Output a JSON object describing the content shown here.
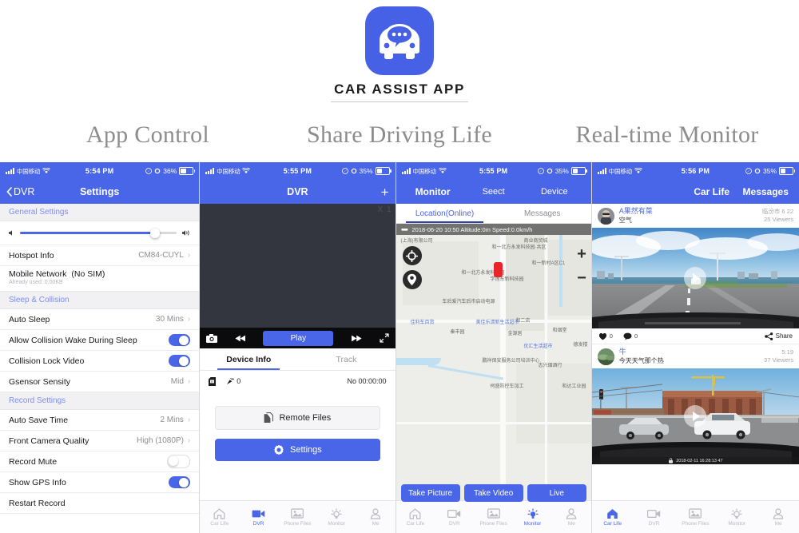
{
  "hero": {
    "logo_title": "CAR ASSIST APP",
    "logo_icon": "car-chat-logo-icon",
    "taglines": [
      "App Control",
      "Share Driving Life",
      "Real-time Monitor"
    ]
  },
  "colors": {
    "accent": "#4a66e8",
    "navbar": "#4a66e8",
    "section_header_text": "#7f8df0",
    "danger": "#e8262a"
  },
  "panels": {
    "settings": {
      "status": {
        "carrier": "中国移动",
        "time": "5:54 PM",
        "battery": "36%"
      },
      "nav": {
        "back_label": "DVR",
        "title": "Settings"
      },
      "section_general": "General Settings",
      "volume_percent": 86,
      "rows": [
        {
          "label": "Hotspot Info",
          "value": "CM84-CUYL",
          "type": "chevron"
        },
        {
          "label": "Mobile Network",
          "value": "(No SIM)",
          "sub": "Already used: 0.00KB",
          "type": "text2"
        }
      ],
      "section_sleep": "Sleep & Collision",
      "rows2": [
        {
          "label": "Auto Sleep",
          "value": "30 Mins",
          "type": "chevron"
        },
        {
          "label": "Allow Collision Wake During Sleep",
          "type": "toggle",
          "on": true
        },
        {
          "label": "Collision Lock Video",
          "type": "toggle",
          "on": true
        },
        {
          "label": "Gsensor Sensity",
          "value": "Mid",
          "type": "chevron"
        }
      ],
      "section_record": "Record Settings",
      "rows3": [
        {
          "label": "Auto Save Time",
          "value": "2 Mins",
          "type": "chevron"
        },
        {
          "label": "Front Camera Quality",
          "value": "High (1080P)",
          "type": "chevron"
        },
        {
          "label": "Record Mute",
          "type": "toggle",
          "on": false
        },
        {
          "label": "Show GPS Info",
          "type": "toggle",
          "on": true
        },
        {
          "label": "Restart Record",
          "type": "plain"
        }
      ]
    },
    "dvr": {
      "status": {
        "carrier": "中国移动",
        "time": "5:55 PM",
        "battery": "35%"
      },
      "nav": {
        "title": "DVR",
        "add_label": "+"
      },
      "video_corner_label": "X 1",
      "controls": {
        "camera_icon": "camera-icon",
        "rewind_icon": "rewind-icon",
        "play_label": "Play",
        "forward_icon": "fast-forward-icon",
        "fullscreen_icon": "fullscreen-icon"
      },
      "tabs": [
        {
          "label": "Device Info",
          "active": true
        },
        {
          "label": "Track",
          "active": false
        }
      ],
      "info": {
        "sd_icon": "sd-card-icon",
        "gps_icon": "satellite-icon",
        "gps_count": "0",
        "record_time": "No 00:00:00"
      },
      "buttons": [
        {
          "label": "Remote Files",
          "icon": "files-icon",
          "style": "light"
        },
        {
          "label": "Settings",
          "icon": "gear-icon",
          "style": "blue"
        }
      ],
      "tabbar": {
        "items": [
          "Car Life",
          "DVR",
          "Phone Files",
          "Monitor",
          "Me"
        ],
        "active_index": 1
      }
    },
    "monitor": {
      "status": {
        "carrier": "中国移动",
        "time": "5:55 PM",
        "battery": "35%"
      },
      "nav": {
        "title": "Monitor",
        "select_label": "Seect",
        "device_label": "Device"
      },
      "tabs": [
        {
          "label": "Location(Online)",
          "active": true
        },
        {
          "label": "Messages",
          "active": false
        }
      ],
      "gps_strip": "2018-06-20 10:50  Altitude:0m  Speed:0.0km/h",
      "map_controls": {
        "locate_icon": "crosshair-icon",
        "pin_icon": "map-pin-icon",
        "zoom_in": "+",
        "zoom_out": "−"
      },
      "map_labels": [
        "(上海)有限公司",
        "和一北方永发科技园·共区",
        "和一新村A区C1",
        "和一北方永发科技园",
        "学莲东新科技园",
        "车后爱汽车后市启动电源",
        "佳利车百货",
        "秦丰园",
        "美佳乐清新生活超市",
        "和二店",
        "金源居",
        "和烟堂",
        "优汇生活超市",
        "德发楼",
        "鹏祥保安服务公司培训中心",
        "志兴烟酒行",
        "柯盛防控车加工",
        "和达工业园",
        "商业商贸城"
      ],
      "buttons": [
        "Take Picture",
        "Take Video",
        "Live"
      ],
      "tabbar": {
        "items": [
          "Car Life",
          "DVR",
          "Phone Files",
          "Monitor",
          "Me"
        ],
        "active_index": 3
      }
    },
    "carlife": {
      "status": {
        "carrier": "中国移动",
        "time": "5:56 PM",
        "battery": "35%"
      },
      "nav": {
        "title": "Car Life",
        "messages_label": "Messages"
      },
      "posts": [
        {
          "user": "A果然有菜",
          "text": "空气",
          "time": "临汾市 6 22",
          "viewers": "25 Viewers",
          "media_alt": "highway-dashcam-video",
          "likes": "0",
          "comments": "0",
          "share_label": "Share"
        },
        {
          "user": "牛",
          "text": "今天天气那个热",
          "time": "5:19",
          "viewers": "37 Viewers",
          "media_alt": "intersection-dashcam-video",
          "timestamp_overlay": "2018-02-11 16:28:13 47"
        }
      ],
      "tabbar": {
        "items": [
          "Car Life",
          "DVR",
          "Phone Files",
          "Monitor",
          "Me"
        ],
        "active_index": 0
      }
    }
  }
}
